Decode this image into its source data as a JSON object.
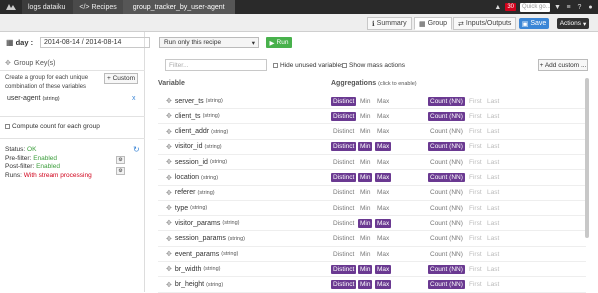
{
  "topbar": {
    "project": "logs dataiku",
    "recipes": "Recipes",
    "current": "group_tracker_by_user-agent",
    "notif_count": "30",
    "search_placeholder": "Quick go..."
  },
  "tabs": [
    {
      "label": "Summary",
      "icon": "info-icon"
    },
    {
      "label": "Group",
      "icon": "grid-icon"
    },
    {
      "label": "Inputs/Outputs",
      "icon": "io-icon"
    }
  ],
  "save_label": "Save",
  "actions_label": "Actions",
  "day_label": "day :",
  "date_value": "2014-08-14 / 2014-08-14",
  "run_select": "Run only this recipe",
  "run_button": "Run",
  "group_keys_title": "Group Key(s)",
  "group_help": "Create a group for each unique combination of these variables",
  "custom_button": "+ Custom",
  "group_key": {
    "name": "user-agent",
    "type": "(string)"
  },
  "compute_count_label": "Compute count for each group",
  "status": {
    "status_label": "Status:",
    "status_value": "OK",
    "prefilter_label": "Pre-filter:",
    "prefilter_value": "Enabled",
    "postfilter_label": "Post-filter:",
    "postfilter_value": "Enabled",
    "runs_label": "Runs:",
    "runs_value": "With stream processing"
  },
  "filter_placeholder": "Filter...",
  "hide_unused_label": "Hide unused variables",
  "show_mass_label": "Show mass actions",
  "add_custom_label": "+ Add custom ...",
  "col_variable": "Variable",
  "col_aggregations": "Aggregations",
  "col_aggregations_hint": "(click to enable)",
  "agg_labels": {
    "distinct": "Distinct",
    "min": "Min",
    "max": "Max",
    "count": "Count (NN)",
    "first": "First",
    "last": "Last"
  },
  "colors": {
    "active": "#6a3991",
    "ok": "#3a9d3a",
    "runs": "#d0021b",
    "save": "#3b86d6",
    "run": "#48b14c"
  },
  "variables": [
    {
      "name": "server_ts",
      "type": "(string)",
      "distinct": true,
      "min": false,
      "max": false,
      "count": true
    },
    {
      "name": "client_ts",
      "type": "(string)",
      "distinct": true,
      "min": false,
      "max": false,
      "count": true
    },
    {
      "name": "client_addr",
      "type": "(string)",
      "distinct": false,
      "min": false,
      "max": false,
      "count": false
    },
    {
      "name": "visitor_id",
      "type": "(string)",
      "distinct": true,
      "min": true,
      "max": true,
      "count": true
    },
    {
      "name": "session_id",
      "type": "(string)",
      "distinct": false,
      "min": false,
      "max": false,
      "count": false
    },
    {
      "name": "location",
      "type": "(string)",
      "distinct": true,
      "min": true,
      "max": true,
      "count": true
    },
    {
      "name": "referer",
      "type": "(string)",
      "distinct": false,
      "min": false,
      "max": false,
      "count": false
    },
    {
      "name": "type",
      "type": "(string)",
      "distinct": false,
      "min": false,
      "max": false,
      "count": false
    },
    {
      "name": "visitor_params",
      "type": "(string)",
      "distinct": false,
      "min": true,
      "max": true,
      "count": false
    },
    {
      "name": "session_params",
      "type": "(string)",
      "distinct": false,
      "min": false,
      "max": false,
      "count": false
    },
    {
      "name": "event_params",
      "type": "(string)",
      "distinct": false,
      "min": false,
      "max": false,
      "count": false
    },
    {
      "name": "br_width",
      "type": "(string)",
      "distinct": true,
      "min": true,
      "max": true,
      "count": true
    },
    {
      "name": "br_height",
      "type": "(string)",
      "distinct": true,
      "min": true,
      "max": true,
      "count": true
    }
  ]
}
